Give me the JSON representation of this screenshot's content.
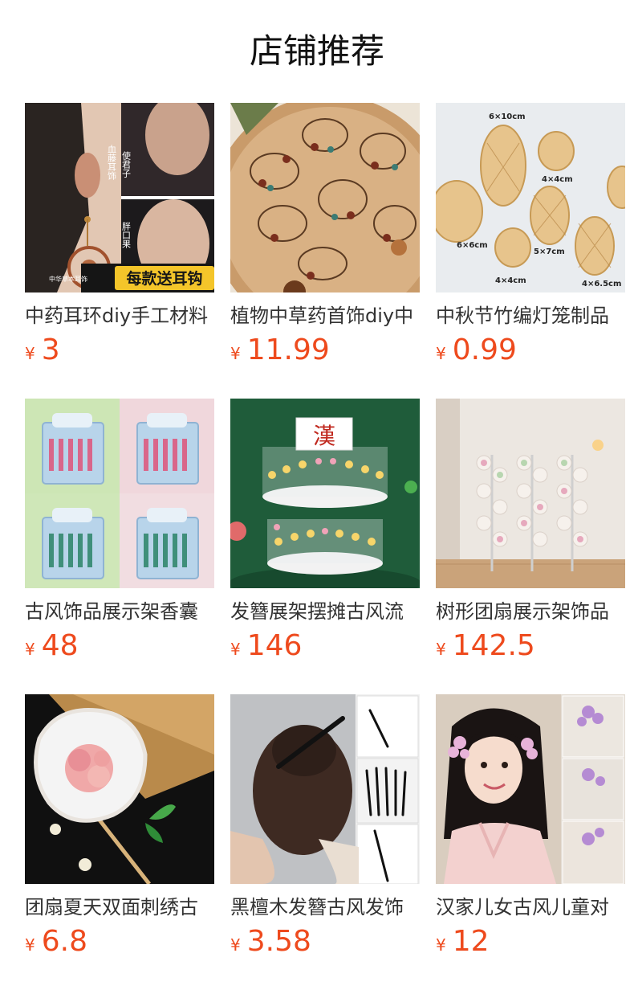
{
  "header": {
    "title": "店铺推荐"
  },
  "products": [
    {
      "name": "中药耳环diy手工材料",
      "currency": "¥",
      "price": "3",
      "image_text": {
        "banner": "每款送耳钩",
        "labels": [
          "血藤耳饰",
          "使君子",
          "胖口果"
        ],
        "brand": "中华草本耳饰"
      }
    },
    {
      "name": "植物中草药首饰diy中",
      "currency": "¥",
      "price": "11.99"
    },
    {
      "name": "中秋节竹编灯笼制品",
      "currency": "¥",
      "price": "0.99",
      "image_text": {
        "sizes": [
          "6×10cm",
          "4×4cm",
          "6×6cm",
          "5×7cm",
          "4×4cm",
          "4×6.5cm"
        ]
      }
    },
    {
      "name": "古风饰品展示架香囊",
      "currency": "¥",
      "price": "48"
    },
    {
      "name": "发簪展架摆摊古风流",
      "currency": "¥",
      "price": "146",
      "image_text": {
        "sign": "漢"
      }
    },
    {
      "name": "树形团扇展示架饰品",
      "currency": "¥",
      "price": "142.5"
    },
    {
      "name": "团扇夏天双面刺绣古",
      "currency": "¥",
      "price": "6.8"
    },
    {
      "name": "黑檀木发簪古风发饰",
      "currency": "¥",
      "price": "3.58"
    },
    {
      "name": "汉家儿女古风儿童对",
      "currency": "¥",
      "price": "12"
    }
  ],
  "colors": {
    "price": "#ee4a1d",
    "title": "#111111",
    "text": "#333333"
  }
}
